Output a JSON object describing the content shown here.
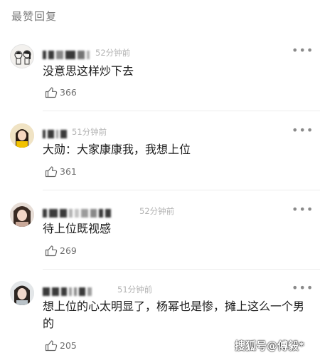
{
  "section": {
    "title": "最赞回复"
  },
  "comments": [
    {
      "time": "52分钟前",
      "text": "没意思这样炒下去",
      "likes": "366"
    },
    {
      "time": "51分钟前",
      "text": "大勋：大家康康我，我想上位",
      "likes": "361"
    },
    {
      "time": "52分钟前",
      "text": "待上位既视感",
      "likes": "269"
    },
    {
      "time": "51分钟前",
      "text": "想上位的心太明显了，杨幂也是惨，摊上这么一个男的",
      "likes": "205"
    }
  ],
  "icons": {
    "more": "more-dots-icon",
    "like": "thumbs-up-icon"
  },
  "watermark": "搜狐号@傅毅*"
}
